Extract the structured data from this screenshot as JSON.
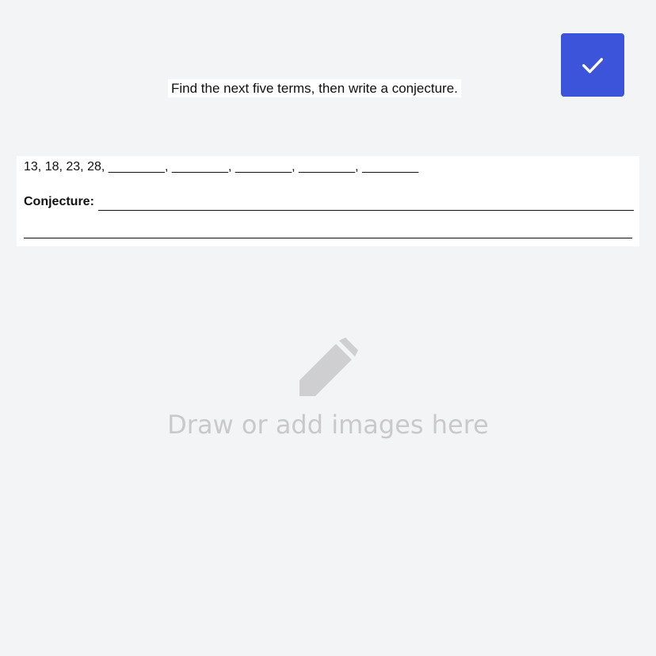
{
  "header": {
    "instruction": "Find the next five terms, then write a conjecture.",
    "check_icon": "checkmark-icon"
  },
  "worksheet": {
    "sequence": "13, 18, 23, 28, ________, ________, ________, ________, ________",
    "conjecture_label": "Conjecture:"
  },
  "draw_area": {
    "icon": "pencil-icon",
    "hint": "Draw or add images here"
  },
  "colors": {
    "accent": "#3b54da",
    "background": "#f3f4f6",
    "hint_text": "#c9c9cc",
    "pencil_icon": "#cfcfd1"
  }
}
